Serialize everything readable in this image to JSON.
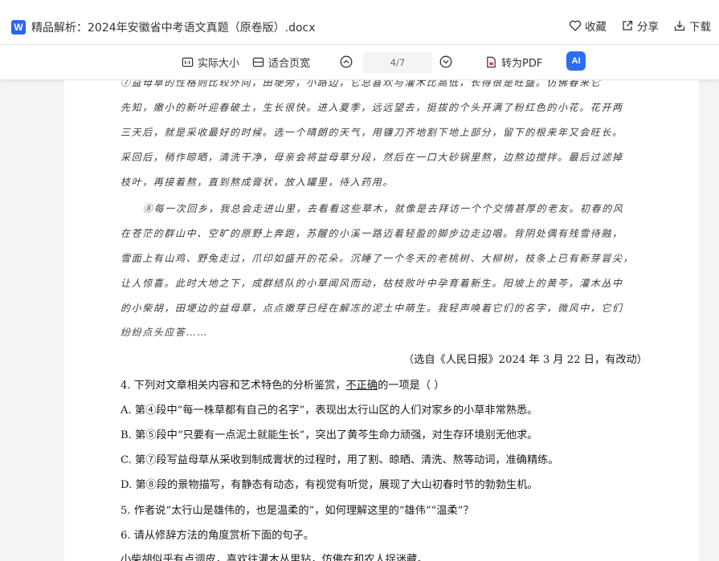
{
  "header": {
    "app_icon_letter": "W",
    "title": "精品解析：2024年安徽省中考语文真题（原卷版）.docx",
    "actions": {
      "favorite": "收藏",
      "share": "分享",
      "download": "下载"
    }
  },
  "toolbar": {
    "actual_size": "实际大小",
    "fit_width": "适合页宽",
    "page_indicator": "4/7",
    "to_pdf": "转为PDF",
    "ai_label": "AI"
  },
  "document": {
    "para7_lines": [
      "⑦益母草的性格则比较外向，田埂旁，小路边，它总喜欢与灌木比高低，长得很是旺盛。仿佛春来它",
      "先知，嫩小的新叶迎春破土，生长很快。进入夏季，远远望去，挺拔的个头开满了粉红色的小花。花开两",
      "三天后，就是采收最好的时候。选一个晴朗的天气，用镰刀齐地割下地上部分，留下的根来年又会旺长。",
      "采回后，稍作晾晒，清洗干净，母亲会将益母草分段，然后在一口大砂锅里熬，边熬边搅拌。最后过滤掉",
      "枝叶，再接着熬，直到熬成膏状，放入罐里，待入药用。"
    ],
    "para8_lines": [
      "⑧每一次回乡，我总会走进山里，去看看这些草木，就像是去拜访一个个交情甚厚的老友。初春的风",
      "在苍茫的群山中、空旷的原野上奔跑，苏醒的小溪一路迈着轻盈的脚步边走边唱。背阴处偶有残雪待融，",
      "雪面上有山鸡、野兔走过，爪印如盛开的花朵。沉睡了一个冬天的老桃树、大柳树，枝条上已有新芽冒尖，",
      "让人惊喜。此时大地之下，成群结队的小草闻风而动，枯枝败叶中孕育着新生。阳坡上的黄芩，灌木丛中",
      "的小柴胡，田埂边的益母草，点点嫩芽已经在解冻的泥土中萌生。我轻声唤着它们的名字，微风中，它们",
      "纷纷点头应答……"
    ],
    "source": "（选自《人民日报》2024 年 3 月 22 日，有改动）",
    "q4_prefix": "4. 下列对文章相关内容和艺术特色的分析鉴赏，",
    "q4_underlined": "不正确",
    "q4_suffix": "的一项是（     ）",
    "options": [
      "A. 第④段中“每一株草都有自己的名字”，表现出太行山区的人们对家乡的小草非常熟悉。",
      "B. 第⑤段中“只要有一点泥土就能生长”，突出了黄芩生命力顽强，对生存环境别无他求。",
      "C. 第⑦段写益母草从采收到制成膏状的过程时，用了割、晾晒、清洗、熬等动词，准确精练。",
      "D. 第⑧段的景物描写，有静态有动态，有视觉有听觉，展现了大山初春时节的勃勃生机。"
    ],
    "q5": "5. 作者说“太行山是雄伟的，也是温柔的”，如何理解这里的“雄伟”“温柔”？",
    "q6": "6. 请从修辞方法的角度赏析下面的句子。",
    "q6_quote_partial": "小柴胡似乎有点调皮，喜欢往灌木丛里钻，仿佛在和农人捉迷藏。"
  }
}
